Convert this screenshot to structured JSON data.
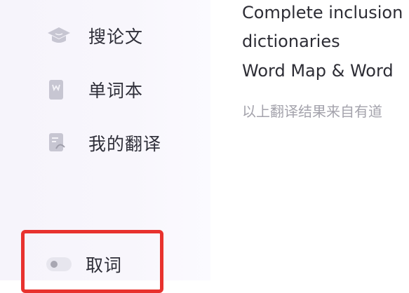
{
  "sidebar": {
    "items": [
      {
        "label": "搜论文",
        "icon": "graduation-cap-icon"
      },
      {
        "label": "单词本",
        "icon": "wordbook-icon"
      },
      {
        "label": "我的翻译",
        "icon": "translation-doc-icon"
      }
    ],
    "toggle": {
      "label": "取词",
      "state": "off"
    }
  },
  "main": {
    "lines": [
      "Complete inclusion",
      "dictionaries",
      "Word Map & Word"
    ],
    "source_note": "以上翻译结果来自有道"
  },
  "colors": {
    "highlight_border": "#e8322e",
    "sidebar_bg": "#f7f5fb"
  }
}
